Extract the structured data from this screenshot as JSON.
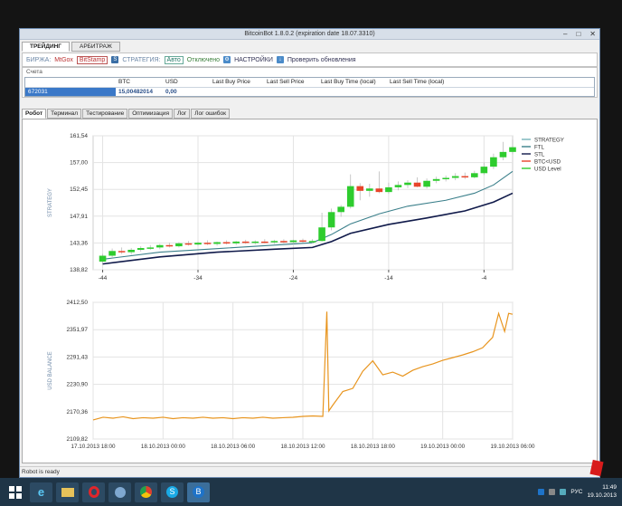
{
  "window": {
    "title": "BitcoinBot 1.8.0.2 (expiration date 18.07.3310)",
    "min": "–",
    "max": "□",
    "close": "✕"
  },
  "top_tabs": [
    "ТРЕЙДИНГ",
    "АРБИТРАЖ"
  ],
  "toolbar": {
    "exchange_label": "БИРЖА:",
    "exchange_1": "MtGox",
    "exchange_2": "BitStamp",
    "strategy_label": "СТРАТЕГИЯ:",
    "strategy_value": "Авто",
    "disabled": "Отключено",
    "settings": "НАСТРОЙКИ",
    "updates": "Проверить обновления"
  },
  "accounts": {
    "caption": "Счета",
    "columns": [
      "BTC",
      "USD",
      "Last Buy Price",
      "Last Sell Price",
      "Last Buy Time (local)",
      "Last Sell Time (local)"
    ],
    "row": {
      "id": "672031",
      "btc": "15,00482014",
      "usd": "0,00"
    }
  },
  "inner_tabs": [
    "Робот",
    "Терминал",
    "Тестирование",
    "Оптимизация",
    "Лог",
    "Лог ошибок"
  ],
  "status": "Robot is ready",
  "taskbar": {
    "lang": "РУС",
    "time": "11:49",
    "date": "19.10.2013"
  },
  "colors": {
    "bull": "#2ecc2e",
    "bear": "#e8452a",
    "strategy": "#76b3b9",
    "ftl": "#3a7f8a",
    "stl": "#101a4a",
    "usd": "#e8951f"
  },
  "chart_data": [
    {
      "type": "candlestick",
      "ylabel": "STRATEGY",
      "yticks": [
        "161,54",
        "157,00",
        "152,45",
        "147,91",
        "143,36",
        "138,82"
      ],
      "xticks": [
        "-44",
        "-34",
        "-24",
        "-14",
        "-4"
      ],
      "ylim": [
        138.82,
        161.54
      ],
      "xlim": [
        -45,
        -1
      ],
      "legend": [
        "STRATEGY",
        "FTL",
        "STL",
        "BTC<USD",
        "USD Level"
      ],
      "legend_position": "top-right",
      "grid": true,
      "candles": [
        [
          -44,
          140.2,
          141.5,
          139.9,
          141.2
        ],
        [
          -43,
          141.2,
          142.4,
          140.8,
          142.0
        ],
        [
          -42,
          142.0,
          142.6,
          141.5,
          141.8
        ],
        [
          -41,
          141.8,
          142.5,
          141.4,
          142.2
        ],
        [
          -40,
          142.2,
          142.8,
          141.9,
          142.5
        ],
        [
          -39,
          142.5,
          143.0,
          142.2,
          142.6
        ],
        [
          -38,
          142.6,
          143.2,
          142.3,
          143.0
        ],
        [
          -37,
          143.0,
          143.4,
          142.6,
          142.8
        ],
        [
          -36,
          142.8,
          143.5,
          142.6,
          143.3
        ],
        [
          -35,
          143.3,
          143.7,
          142.9,
          143.1
        ],
        [
          -34,
          143.1,
          143.6,
          142.9,
          143.4
        ],
        [
          -33,
          143.4,
          143.8,
          143.0,
          143.2
        ],
        [
          -32,
          143.2,
          143.6,
          142.9,
          143.5
        ],
        [
          -31,
          143.5,
          143.8,
          143.1,
          143.3
        ],
        [
          -30,
          143.3,
          143.7,
          143.0,
          143.6
        ],
        [
          -29,
          143.6,
          143.9,
          143.2,
          143.4
        ],
        [
          -28,
          143.4,
          143.8,
          143.1,
          143.6
        ],
        [
          -27,
          143.6,
          144.0,
          143.3,
          143.5
        ],
        [
          -26,
          143.5,
          143.9,
          143.2,
          143.7
        ],
        [
          -25,
          143.7,
          144.0,
          143.3,
          143.5
        ],
        [
          -24,
          143.5,
          143.9,
          143.2,
          143.8
        ],
        [
          -23,
          143.8,
          144.1,
          143.4,
          143.6
        ],
        [
          -22,
          143.6,
          144.0,
          143.3,
          143.7
        ],
        [
          -21,
          143.7,
          148.5,
          143.6,
          146.0
        ],
        [
          -20,
          146.0,
          149.2,
          145.5,
          148.6
        ],
        [
          -19,
          148.6,
          149.8,
          147.8,
          149.5
        ],
        [
          -18,
          149.5,
          155.0,
          149.2,
          153.0
        ],
        [
          -17,
          153.0,
          153.5,
          150.6,
          152.2
        ],
        [
          -16,
          152.2,
          153.4,
          151.2,
          152.6
        ],
        [
          -15,
          152.6,
          155.5,
          151.8,
          152.0
        ],
        [
          -14,
          152.0,
          153.6,
          151.7,
          152.8
        ],
        [
          -13,
          152.8,
          153.8,
          152.3,
          153.2
        ],
        [
          -12,
          153.2,
          154.0,
          152.7,
          153.6
        ],
        [
          -11,
          153.6,
          154.5,
          152.8,
          152.9
        ],
        [
          -10,
          152.9,
          154.3,
          152.6,
          153.9
        ],
        [
          -9,
          153.9,
          154.6,
          153.5,
          154.2
        ],
        [
          -8,
          154.2,
          154.8,
          153.8,
          154.4
        ],
        [
          -7,
          154.4,
          155.2,
          154.0,
          154.7
        ],
        [
          -6,
          154.7,
          155.3,
          154.2,
          154.5
        ],
        [
          -5,
          154.5,
          155.6,
          154.3,
          155.2
        ],
        [
          -4,
          155.2,
          157.0,
          154.9,
          156.3
        ],
        [
          -3,
          156.3,
          158.5,
          155.9,
          157.9
        ],
        [
          -2,
          157.9,
          160.5,
          157.4,
          158.8
        ],
        [
          -1,
          158.8,
          160.9,
          158.4,
          159.6
        ]
      ],
      "series": [
        {
          "name": "FTL",
          "values": [
            [
              -44,
              140.6
            ],
            [
              -38,
              141.8
            ],
            [
              -32,
              142.4
            ],
            [
              -26,
              143.0
            ],
            [
              -22,
              143.4
            ],
            [
              -20,
              144.8
            ],
            [
              -18,
              146.6
            ],
            [
              -15,
              148.3
            ],
            [
              -12,
              149.6
            ],
            [
              -8,
              150.6
            ],
            [
              -5,
              151.8
            ],
            [
              -3,
              153.2
            ],
            [
              -1,
              155.5
            ]
          ]
        },
        {
          "name": "STL",
          "values": [
            [
              -44,
              139.8
            ],
            [
              -38,
              141.0
            ],
            [
              -32,
              141.8
            ],
            [
              -26,
              142.3
            ],
            [
              -22,
              142.6
            ],
            [
              -20,
              143.6
            ],
            [
              -18,
              145.0
            ],
            [
              -14,
              146.5
            ],
            [
              -10,
              147.6
            ],
            [
              -6,
              148.8
            ],
            [
              -3,
              150.3
            ],
            [
              -1,
              151.8
            ]
          ]
        }
      ]
    },
    {
      "type": "line",
      "ylabel": "USD BALANCE",
      "yticks": [
        "2412,50",
        "2351,97",
        "2291,43",
        "2230,90",
        "2170,36",
        "2109,82"
      ],
      "xticks": [
        "17.10.2013 18:00",
        "18.10.2013 00:00",
        "18.10.2013 06:00",
        "18.10.2013 12:00",
        "18.10.2013 18:00",
        "19.10.2013 00:00",
        "19.10.2013 06:00"
      ],
      "ylim": [
        2109.82,
        2412.5
      ],
      "xlim": [
        0,
        42
      ],
      "grid": true,
      "series": [
        {
          "name": "USD Level",
          "values": [
            [
              0,
              2152
            ],
            [
              1,
              2158
            ],
            [
              2,
              2156
            ],
            [
              3,
              2159
            ],
            [
              4,
              2155
            ],
            [
              5,
              2157
            ],
            [
              6,
              2156
            ],
            [
              7,
              2158
            ],
            [
              8,
              2155
            ],
            [
              9,
              2157
            ],
            [
              10,
              2156
            ],
            [
              11,
              2158
            ],
            [
              12,
              2156
            ],
            [
              13,
              2157
            ],
            [
              14,
              2155
            ],
            [
              15,
              2157
            ],
            [
              16,
              2156
            ],
            [
              17,
              2158
            ],
            [
              18,
              2156
            ],
            [
              19,
              2157
            ],
            [
              20,
              2158
            ],
            [
              21,
              2160
            ],
            [
              22,
              2161
            ],
            [
              23,
              2160
            ],
            [
              23.4,
              2392
            ],
            [
              23.6,
              2172
            ],
            [
              24,
              2185
            ],
            [
              25,
              2215
            ],
            [
              26,
              2222
            ],
            [
              27,
              2260
            ],
            [
              28,
              2283
            ],
            [
              29,
              2252
            ],
            [
              30,
              2258
            ],
            [
              31,
              2249
            ],
            [
              32,
              2262
            ],
            [
              33,
              2270
            ],
            [
              34,
              2276
            ],
            [
              35,
              2284
            ],
            [
              36,
              2290
            ],
            [
              37,
              2296
            ],
            [
              38,
              2303
            ],
            [
              39,
              2312
            ],
            [
              40,
              2335
            ],
            [
              40.6,
              2388
            ],
            [
              41.2,
              2348
            ],
            [
              41.6,
              2388
            ],
            [
              42,
              2386
            ]
          ]
        }
      ]
    }
  ]
}
